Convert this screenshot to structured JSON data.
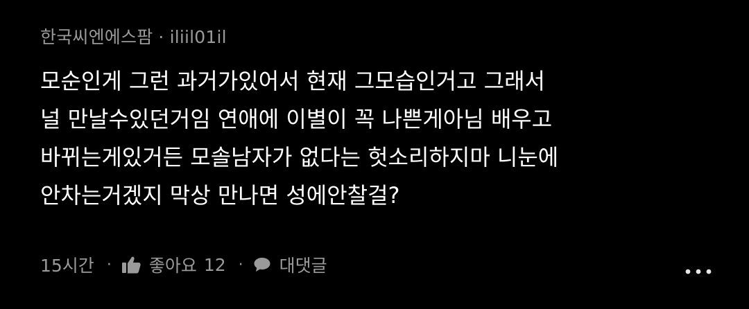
{
  "comment": {
    "author": "한국씨엔에스팜",
    "meta_separator": "·",
    "handle": "iliil01il",
    "body_lines": [
      "모순인게 그런 과거가있어서 현재 그모습인거고 그래서",
      "널 만날수있던거임 연애에 이별이 꼭 나쁜게아님 배우고",
      "바뀌는게있거든 모솔남자가 없다는 헛소리하지마 니눈에",
      "안차는거겠지 막상 만나면 성에안찰걸?"
    ],
    "time": "15시간",
    "action_separator": "·",
    "like_label": "좋아요",
    "like_count": "12",
    "reply_label": "대댓글",
    "icons": {
      "like": "thumbs-up-icon",
      "reply": "chat-bubble-icon",
      "more": "more-dots-icon"
    }
  },
  "colors": {
    "background": "#000000",
    "text": "#ffffff",
    "muted": "#9a9a9a"
  }
}
